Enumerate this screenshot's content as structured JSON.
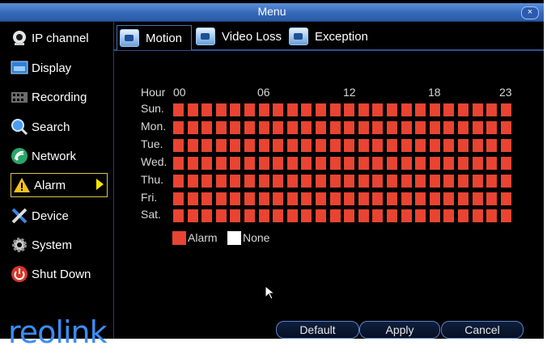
{
  "window": {
    "title": "Menu",
    "close_label": "×"
  },
  "sidebar": {
    "items": [
      {
        "label": "IP channel",
        "icon": "camera-icon"
      },
      {
        "label": "Display",
        "icon": "display-icon"
      },
      {
        "label": "Recording",
        "icon": "film-icon"
      },
      {
        "label": "Search",
        "icon": "search-icon"
      },
      {
        "label": "Network",
        "icon": "network-icon"
      },
      {
        "label": "Alarm",
        "icon": "warning-icon"
      },
      {
        "label": "Device",
        "icon": "tools-icon"
      },
      {
        "label": "System",
        "icon": "gear-icon"
      },
      {
        "label": "Shut Down",
        "icon": "power-icon"
      }
    ],
    "active": "Alarm",
    "logo": "reolink"
  },
  "tabs": [
    {
      "label": "Motion"
    },
    {
      "label": "Video Loss"
    },
    {
      "label": "Exception"
    }
  ],
  "active_tab": "Motion",
  "schedule": {
    "hour_label": "Hour",
    "hour_ticks": [
      "00",
      "06",
      "12",
      "18",
      "23"
    ],
    "days": [
      "Sun.",
      "Mon.",
      "Tue.",
      "Wed.",
      "Thu.",
      "Fri.",
      "Sat."
    ],
    "hours_per_day": 24,
    "all_cells_state": "Alarm"
  },
  "legend": [
    {
      "label": "Alarm",
      "color": "#e84431"
    },
    {
      "label": "None",
      "color": "#ffffff"
    }
  ],
  "buttons": {
    "default_label": "Default",
    "apply_label": "Apply",
    "cancel_label": "Cancel"
  },
  "colors": {
    "accent": "#3569b8",
    "alarm": "#e84431",
    "active_border": "#d8c64a"
  }
}
